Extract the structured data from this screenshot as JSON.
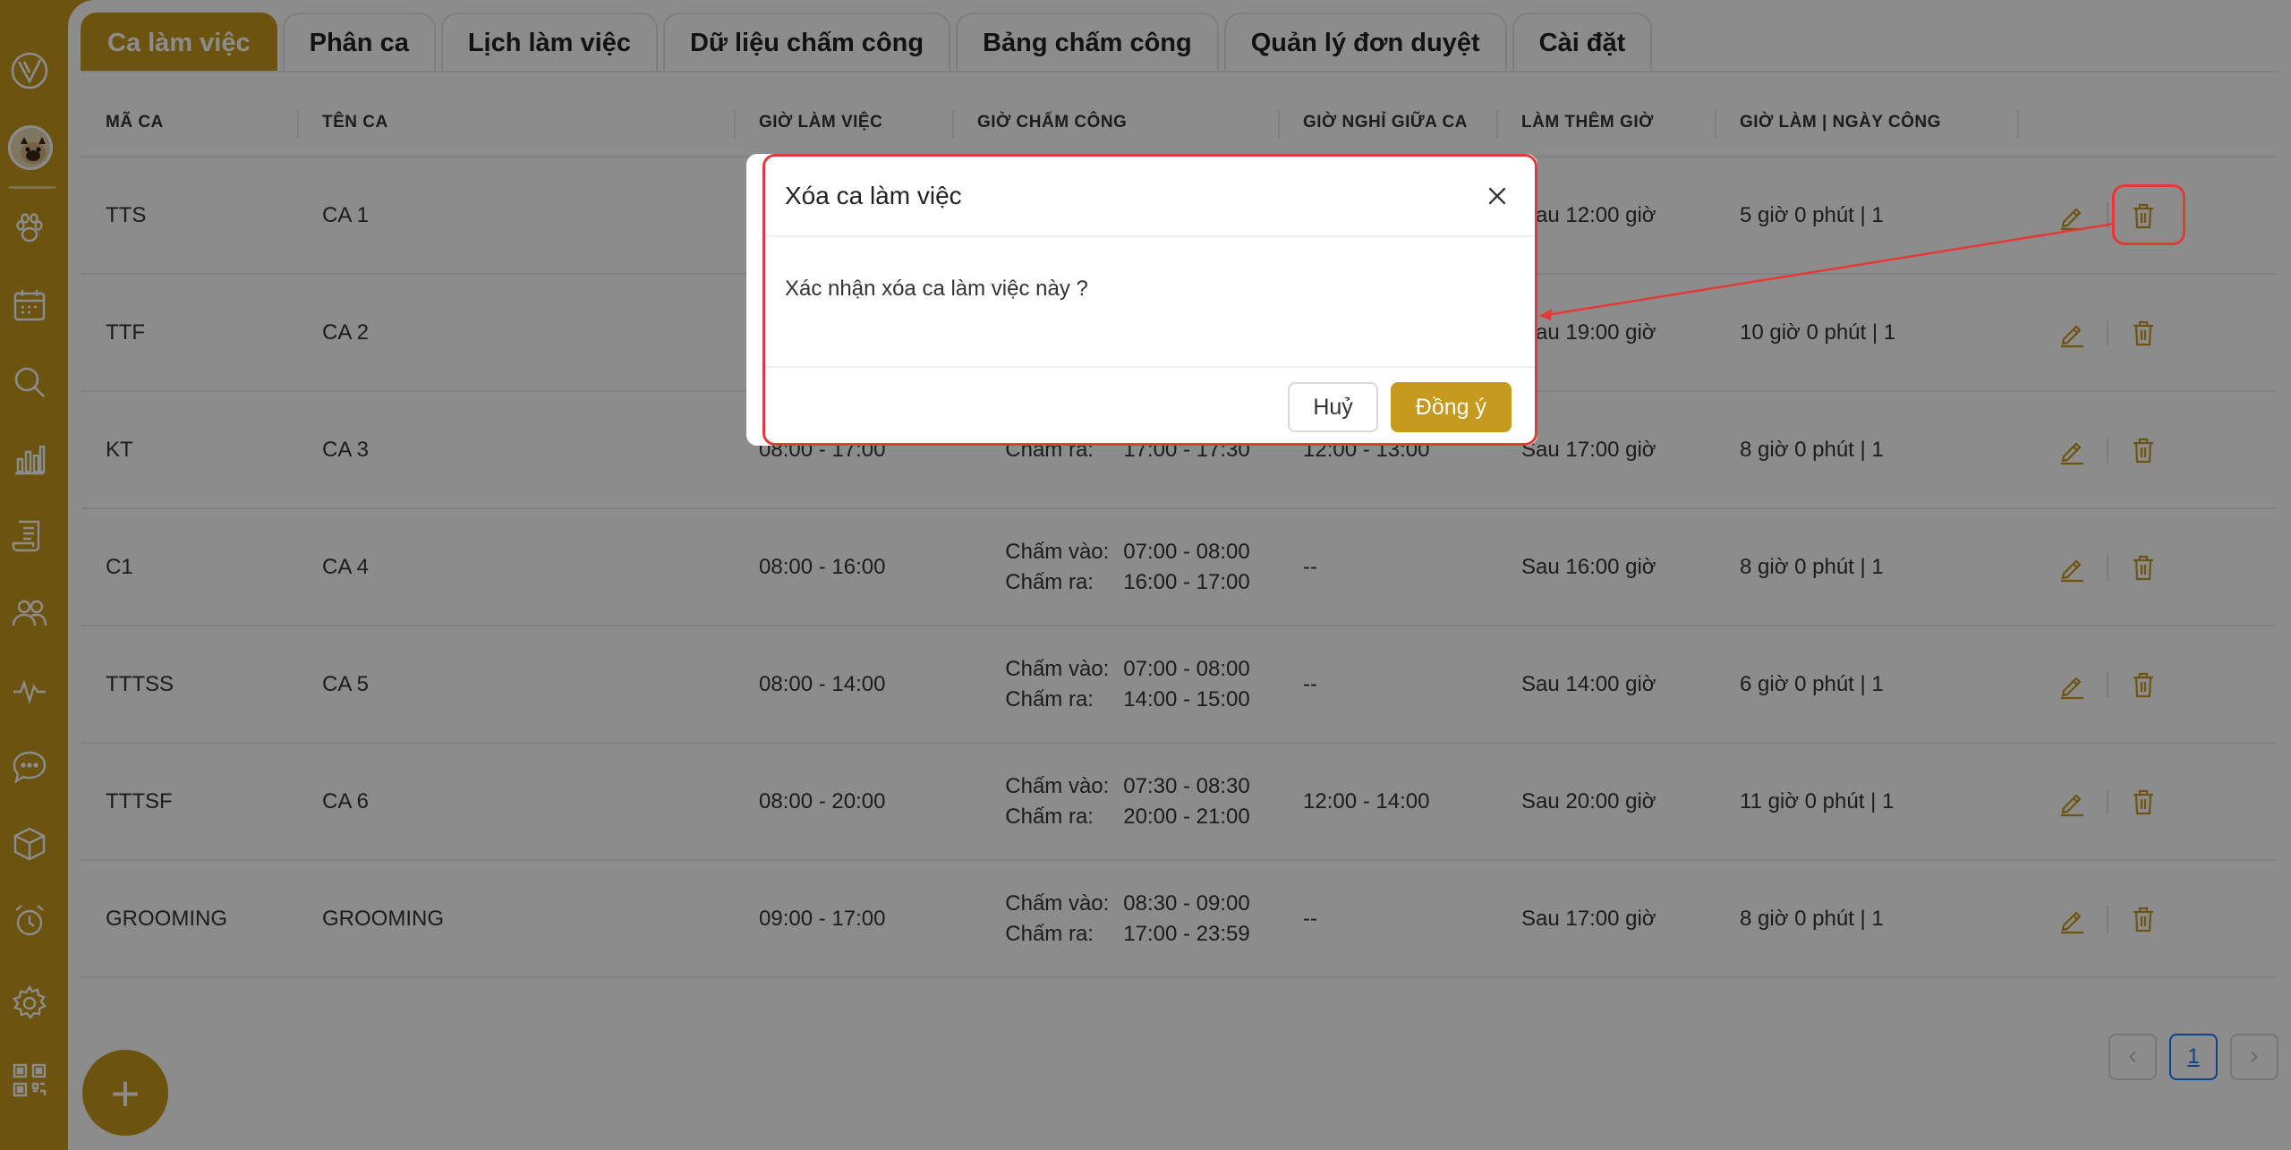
{
  "tabs": [
    {
      "label": "Ca làm việc",
      "active": true
    },
    {
      "label": "Phân ca"
    },
    {
      "label": "Lịch làm việc"
    },
    {
      "label": "Dữ liệu chấm công"
    },
    {
      "label": "Bảng chấm công"
    },
    {
      "label": "Quản lý đơn duyệt"
    },
    {
      "label": "Cài đặt"
    }
  ],
  "table": {
    "headers": [
      "MÃ CA",
      "TÊN CA",
      "GIỜ LÀM VIỆC",
      "GIỜ CHẤM CÔNG",
      "GIỜ NGHỈ GIỮA CA",
      "LÀM THÊM GIỜ",
      "GIỜ LÀM | NGÀY CÔNG"
    ],
    "checkin_label": "Chấm vào:",
    "checkout_label": "Chấm ra:",
    "rows": [
      {
        "code": "TTS",
        "name": "CA 1",
        "work": "",
        "in": "",
        "out": "",
        "break": "",
        "ot": "Sau 12:00 giờ",
        "total": "5 giờ 0 phút | 1"
      },
      {
        "code": "TTF",
        "name": "CA 2",
        "work": "",
        "in": "",
        "out": "",
        "break": "",
        "ot": "Sau 19:00 giờ",
        "total": "10 giờ 0 phút | 1"
      },
      {
        "code": "KT",
        "name": "CA 3",
        "work": "08:00 - 17:00",
        "in": "",
        "out": "17:00 - 17:30",
        "break": "12:00 - 13:00",
        "ot": "Sau 17:00 giờ",
        "total": "8 giờ 0 phút | 1"
      },
      {
        "code": "C1",
        "name": "CA 4",
        "work": "08:00 - 16:00",
        "in": "07:00 - 08:00",
        "out": "16:00 - 17:00",
        "break": "--",
        "ot": "Sau 16:00 giờ",
        "total": "8 giờ 0 phút | 1"
      },
      {
        "code": "TTTSS",
        "name": "CA 5",
        "work": "08:00 - 14:00",
        "in": "07:00 - 08:00",
        "out": "14:00 - 15:00",
        "break": "--",
        "ot": "Sau 14:00 giờ",
        "total": "6 giờ 0 phút | 1"
      },
      {
        "code": "TTTSF",
        "name": "CA 6",
        "work": "08:00 - 20:00",
        "in": "07:30 - 08:30",
        "out": "20:00 - 21:00",
        "break": "12:00 - 14:00",
        "ot": "Sau 20:00 giờ",
        "total": "11 giờ 0 phút | 1"
      },
      {
        "code": "GROOMING",
        "name": "GROOMING",
        "work": "09:00 - 17:00",
        "in": "08:30 - 09:00",
        "out": "17:00 - 23:59",
        "break": "--",
        "ot": "Sau 17:00 giờ",
        "total": "8 giờ 0 phút | 1"
      }
    ]
  },
  "pagination": {
    "current": "1"
  },
  "fab": {
    "label": "+"
  },
  "modal": {
    "title": "Xóa ca làm việc",
    "message": "Xác nhận xóa ca làm việc này ?",
    "cancel": "Huỷ",
    "confirm": "Đồng ý"
  },
  "colors": {
    "accent": "#c59a1e",
    "highlight": "#e53935",
    "page_link": "#1677ff"
  },
  "sidebar_icons": [
    "logo-icon",
    "avatar",
    "paw-icon",
    "calendar-icon",
    "search-icon",
    "chart-icon",
    "document-icon",
    "users-icon",
    "pulse-icon",
    "chat-icon",
    "box-icon",
    "alarm-icon",
    "gear-icon",
    "qr-icon"
  ]
}
